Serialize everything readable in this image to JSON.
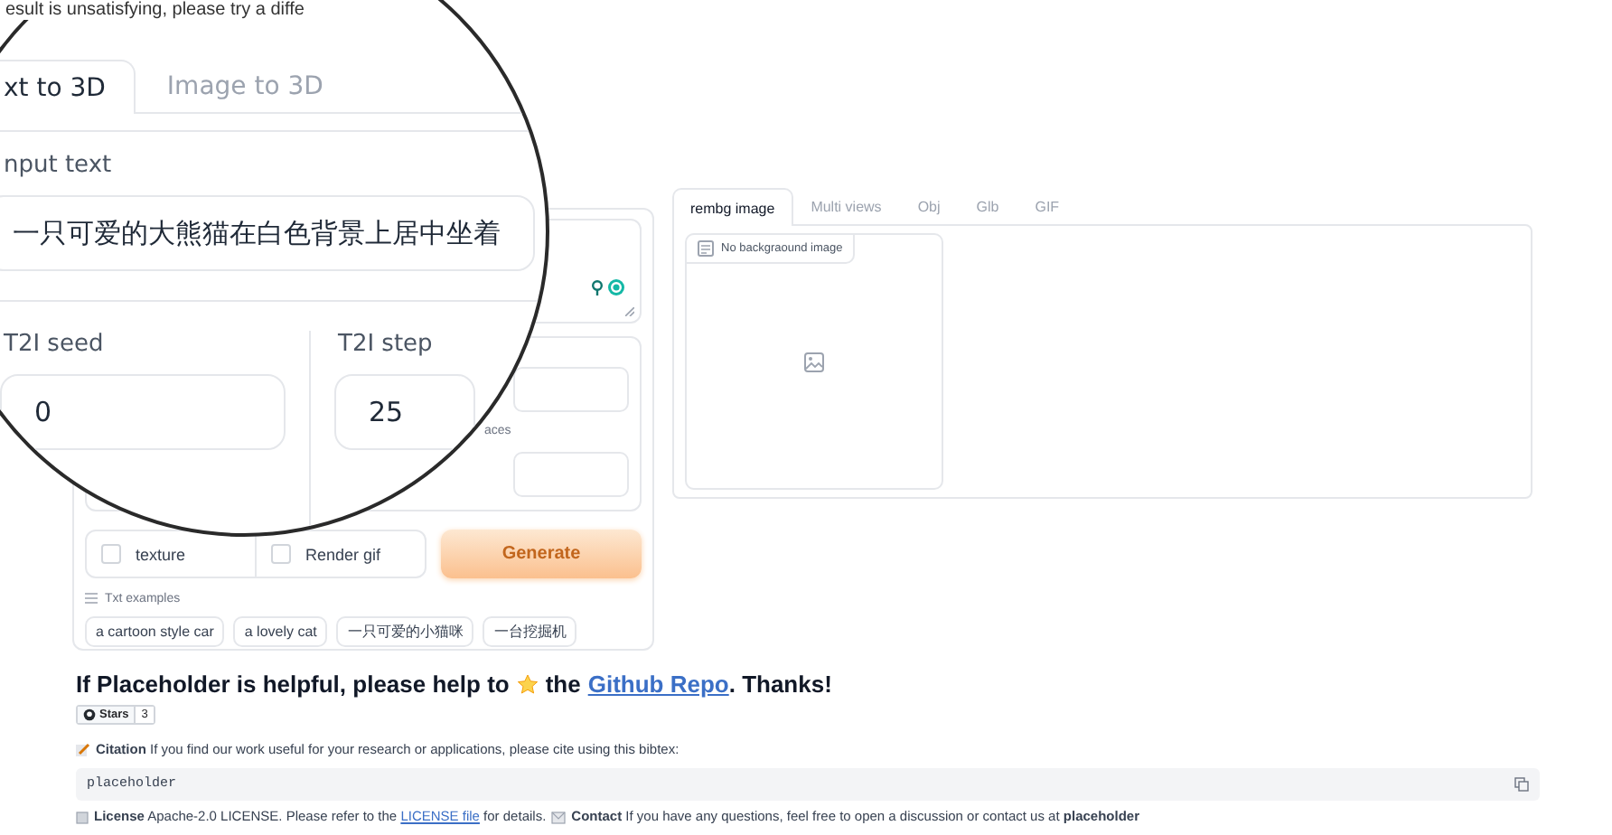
{
  "notice_text": "esult is unsatisfying, please try a diffe",
  "magnifier": {
    "tabs": [
      {
        "label": "xt to 3D",
        "selected": true
      },
      {
        "label": "Image to 3D",
        "selected": false
      }
    ],
    "input_label": "nput text",
    "input_value": "一只可爱的大熊猫在白色背景上居中坐着",
    "fields": [
      {
        "label": "T2I seed",
        "value": "0"
      },
      {
        "label": "T2I step",
        "value": "25"
      }
    ]
  },
  "options": {
    "partial_label": "aces",
    "checkboxes": [
      {
        "label": "texture",
        "checked": false
      },
      {
        "label": "Render gif",
        "checked": false
      }
    ],
    "generate_button": "Generate",
    "examples_label": "Txt examples",
    "examples": [
      "a cartoon style car",
      "a lovely cat",
      "一只可爱的小猫咪",
      "一台挖掘机"
    ]
  },
  "output": {
    "tabs": [
      {
        "label": "rembg image",
        "selected": true
      },
      {
        "label": "Multi views",
        "selected": false
      },
      {
        "label": "Obj",
        "selected": false
      },
      {
        "label": "Glb",
        "selected": false
      },
      {
        "label": "GIF",
        "selected": false
      }
    ],
    "image_label": "No backgraound image"
  },
  "footer": {
    "heading_start": "If Placeholder is helpful, please help to",
    "heading_middle": "the",
    "heading_link": "Github Repo",
    "heading_end": ". Thanks!",
    "stars_label": "Stars",
    "stars_count": "3",
    "citation": "**Citation** If you find our work useful for your research or applications, please cite using this bibtex:",
    "code": "placeholder",
    "license_start": "**License** Apache-2.0 LICENSE. Please refer to the",
    "license_link": "LICENSE file",
    "license_end": "for details.",
    "contact": "**Contact** If you have any questions, feel free to open a discussion or contact us at **placeholder**"
  }
}
